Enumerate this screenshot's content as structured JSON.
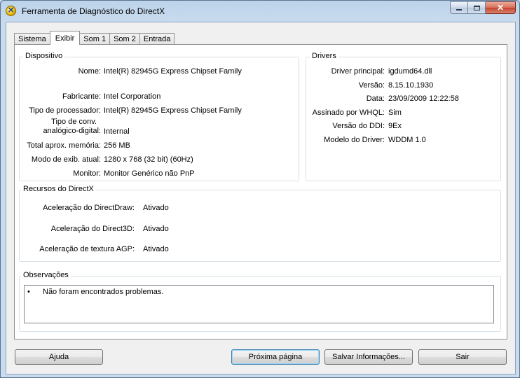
{
  "window": {
    "title": "Ferramenta de Diagnóstico do DirectX"
  },
  "tabs": [
    {
      "label": "Sistema",
      "active": false
    },
    {
      "label": "Exibir",
      "active": true
    },
    {
      "label": "Som 1",
      "active": false
    },
    {
      "label": "Som 2",
      "active": false
    },
    {
      "label": "Entrada",
      "active": false
    }
  ],
  "device": {
    "title": "Dispositivo",
    "fields": [
      {
        "label": "Nome:",
        "value": "Intel(R) 82945G Express Chipset Family"
      },
      {
        "label": "Fabricante:",
        "value": "Intel Corporation"
      },
      {
        "label": "Tipo de processador:",
        "value": "Intel(R) 82945G Express Chipset Family"
      },
      {
        "label_line1": "Tipo de conv.",
        "label_line2": "analógico-digital:",
        "value": "Internal"
      },
      {
        "label": "Total aprox. memória:",
        "value": "256 MB"
      },
      {
        "label": "Modo de exib. atual:",
        "value": "1280 x 768 (32 bit) (60Hz)"
      },
      {
        "label": "Monitor:",
        "value": "Monitor Genérico não PnP"
      }
    ]
  },
  "drivers": {
    "title": "Drivers",
    "fields": [
      {
        "label": "Driver principal:",
        "value": "igdumd64.dll"
      },
      {
        "label": "Versão:",
        "value": "8.15.10.1930"
      },
      {
        "label": "Data:",
        "value": "23/09/2009 12:22:58"
      },
      {
        "label": "Assinado por WHQL:",
        "value": "Sim"
      },
      {
        "label": "Versão do DDI:",
        "value": "9Ex"
      },
      {
        "label": "Modelo do Driver:",
        "value": "WDDM 1.0"
      }
    ]
  },
  "features": {
    "title": "Recursos do DirectX",
    "fields": [
      {
        "label": "Aceleração do DirectDraw:",
        "value": "Ativado"
      },
      {
        "label": "Aceleração do Direct3D:",
        "value": "Ativado"
      },
      {
        "label": "Aceleração de textura AGP:",
        "value": "Ativado"
      }
    ]
  },
  "notes": {
    "title": "Observações",
    "bullet": "•",
    "items": [
      "Não foram encontrados problemas."
    ]
  },
  "buttons": {
    "help": "Ajuda",
    "next": "Próxima página",
    "save": "Salvar Informações...",
    "exit": "Sair"
  }
}
